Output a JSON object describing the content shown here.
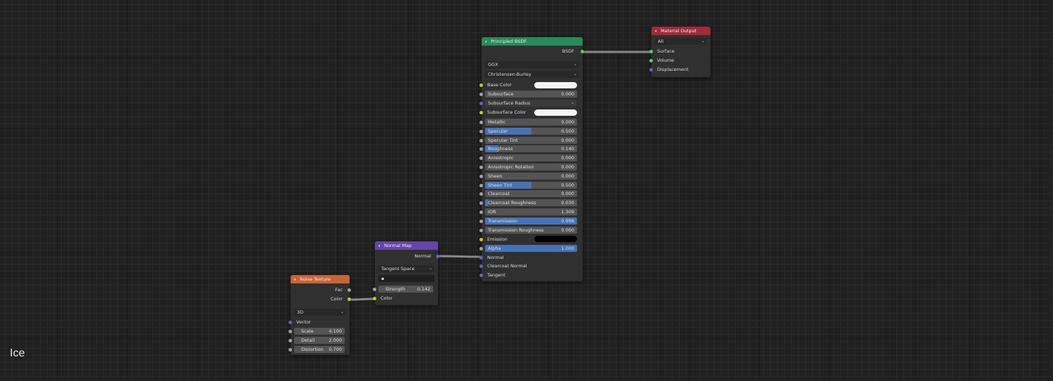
{
  "colors": {
    "shader_header": "#2a8a5a",
    "output_header": "#a02b3a",
    "vector_header": "#6446a6",
    "texture_header": "#c8643a",
    "field_fill": "#4772b3",
    "socket_shader": "#63c763",
    "socket_color": "#c7c729",
    "socket_float": "#a1a1a1",
    "socket_vector": "#6363c7"
  },
  "material_name": "Ice",
  "principled": {
    "title": "Principled BSDF",
    "output": "BSDF",
    "distribution": "GGX",
    "subsurface_method": "Christensen-Burley",
    "base_color_label": "Base Color",
    "base_color": "#f4f4f4",
    "subsurface": {
      "label": "Subsurface",
      "value": "0.000",
      "fraction": 0
    },
    "subsurface_radius": "Subsurface Radius",
    "subsurface_color_label": "Subsurface Color",
    "subsurface_color": "#f4f4f4",
    "metallic": {
      "label": "Metallic",
      "value": "0.000",
      "fraction": 0
    },
    "specular": {
      "label": "Specular",
      "value": "0.500",
      "fraction": 0.5
    },
    "specular_tint": {
      "label": "Specular Tint",
      "value": "0.000",
      "fraction": 0
    },
    "roughness": {
      "label": "Roughness",
      "value": "0.140",
      "fraction": 0.14
    },
    "anisotropic": {
      "label": "Anisotropic",
      "value": "0.000",
      "fraction": 0
    },
    "anisotropic_rotation": {
      "label": "Anisotropic Rotation",
      "value": "0.000",
      "fraction": 0
    },
    "sheen": {
      "label": "Sheen",
      "value": "0.000",
      "fraction": 0
    },
    "sheen_tint": {
      "label": "Sheen Tint",
      "value": "0.500",
      "fraction": 0.5
    },
    "clearcoat": {
      "label": "Clearcoat",
      "value": "0.000",
      "fraction": 0
    },
    "clearcoat_roughness": {
      "label": "Clearcoat Roughness",
      "value": "0.030",
      "fraction": 0.03
    },
    "ior": {
      "label": "IOR",
      "value": "1.309",
      "fraction": 0
    },
    "transmission": {
      "label": "Transmission",
      "value": "0.998",
      "fraction": 0.998
    },
    "transmission_roughness": {
      "label": "Transmission Roughness",
      "value": "0.000",
      "fraction": 0
    },
    "emission_label": "Emission",
    "emission_color": "#000000",
    "alpha": {
      "label": "Alpha",
      "value": "1.000",
      "fraction": 1
    },
    "normal": "Normal",
    "clearcoat_normal": "Clearcoat Normal",
    "tangent": "Tangent"
  },
  "material_output": {
    "title": "Material Output",
    "target": "All",
    "surface": "Surface",
    "volume": "Volume",
    "displacement": "Displacement"
  },
  "normal_map": {
    "title": "Normal Map",
    "output": "Normal",
    "space": "Tangent Space",
    "uv_map": "",
    "strength": {
      "label": "Strength",
      "value": "0.142",
      "fraction": 0
    },
    "color": "Color"
  },
  "noise_texture": {
    "title": "Noise Texture",
    "fac": "Fac",
    "color": "Color",
    "dimensions": "3D",
    "vector": "Vector",
    "scale": {
      "label": "Scale",
      "value": "4.100",
      "fraction": 0
    },
    "detail": {
      "label": "Detail",
      "value": "2.000",
      "fraction": 0
    },
    "distortion": {
      "label": "Distortion",
      "value": "0.700",
      "fraction": 0
    }
  }
}
